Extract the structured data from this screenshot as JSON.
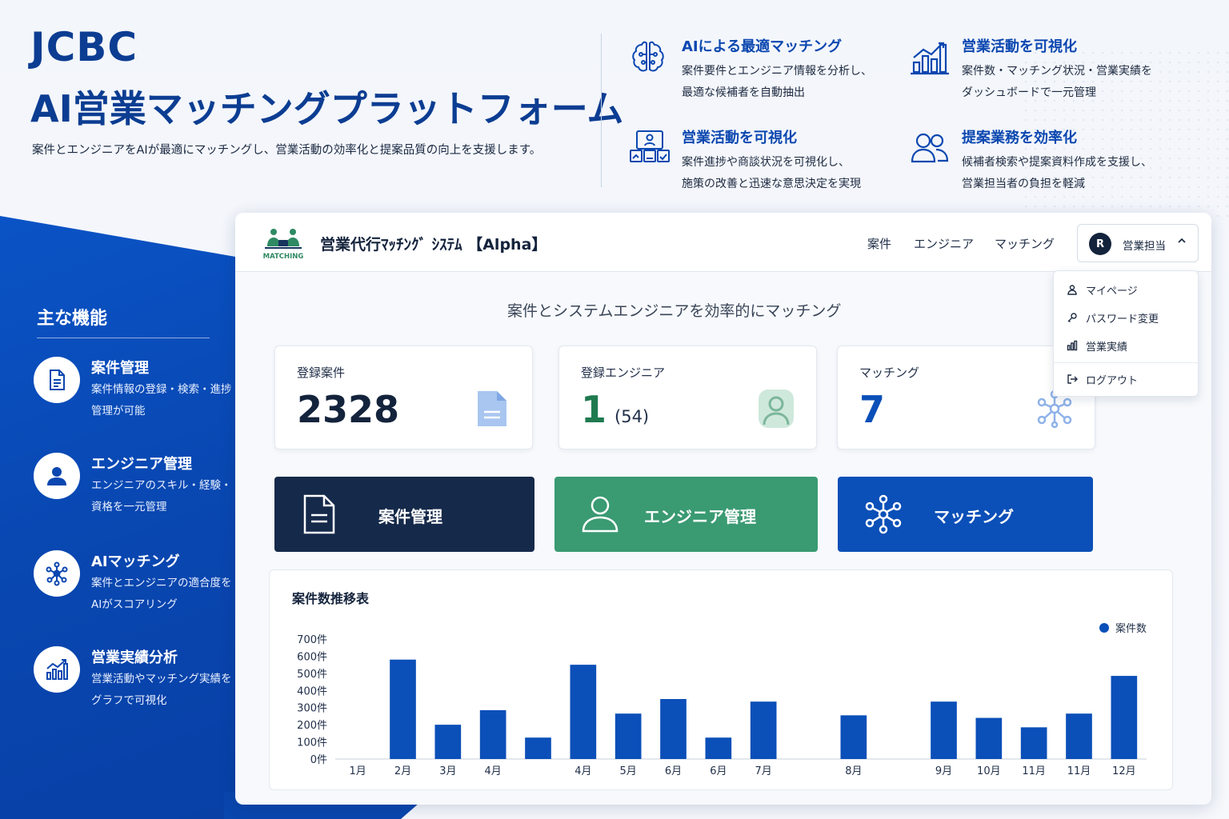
{
  "hero": {
    "title_line1": "JCBC",
    "title_line2": "AI営業マッチングプラットフォーム",
    "subtitle": "案件とエンジニアをAIが最適にマッチングし、営業活動の効率化と提案品質の向上を支援します。"
  },
  "features": [
    {
      "icon": "brain-icon",
      "title": "AIによる最適マッチング",
      "line1": "案件要件とエンジニア情報を分析し、",
      "line2": "最適な候補者を自動抽出"
    },
    {
      "icon": "bar-chart-icon",
      "title": "営業活動を可視化",
      "line1": "案件数・マッチング状況・営業実績を",
      "line2": "ダッシュボードで一元管理"
    },
    {
      "icon": "team-board-icon",
      "title": "営業活動を可視化",
      "line1": "案件進捗や商談状況を可視化し、",
      "line2": "施策の改善と迅速な意思決定を実現"
    },
    {
      "icon": "users-icon",
      "title": "提案業務を効率化",
      "line1": "候補者検索や提案資料作成を支援し、",
      "line2": "営業担当者の負担を軽減"
    }
  ],
  "side": {
    "heading": "主な機能",
    "items": [
      {
        "icon": "document-icon",
        "title": "案件管理",
        "desc": "案件情報の登録・検索・進捗管理が可能"
      },
      {
        "icon": "person-icon",
        "title": "エンジニア管理",
        "desc": "エンジニアのスキル・経験・資格を一元管理"
      },
      {
        "icon": "network-icon",
        "title": "AIマッチング",
        "desc": "案件とエンジニアの適合度をAIがスコアリング"
      },
      {
        "icon": "analytics-icon",
        "title": "営業実績分析",
        "desc": "営業活動やマッチング実績をグラフで可視化"
      }
    ]
  },
  "app": {
    "logo_text": "MATCHING",
    "title": "営業代行ﾏｯﾁﾝｸﾞ ｼｽﾃﾑ 【Alpha】",
    "nav": [
      "案件",
      "エンジニア",
      "マッチング"
    ],
    "user": {
      "initial": "R",
      "name": "営業担当"
    },
    "menu": [
      {
        "icon": "user-icon",
        "label": "マイページ"
      },
      {
        "icon": "key-icon",
        "label": "パスワード変更"
      },
      {
        "icon": "chart-icon",
        "label": "営業実績"
      },
      {
        "icon": "logout-icon",
        "label": "ログアウト"
      }
    ],
    "tagline": "案件とシステムエンジニアを効率的にマッチング",
    "stats": [
      {
        "label": "登録案件",
        "value": "2328",
        "sub": "",
        "color": "#14233c"
      },
      {
        "label": "登録エンジニア",
        "value": "1",
        "sub": "(54)",
        "color": "#1f7a4f"
      },
      {
        "label": "マッチング",
        "value": "7",
        "sub": "",
        "color": "#0b4fb8"
      }
    ],
    "actions": [
      {
        "label": "案件管理",
        "color": "#15294a"
      },
      {
        "label": "エンジニア管理",
        "color": "#3a9a72"
      },
      {
        "label": "マッチング",
        "color": "#0b4fb8"
      }
    ]
  },
  "chart_data": {
    "type": "bar",
    "title": "案件数推移表",
    "series": [
      {
        "name": "案件数",
        "color": "#0b4fb8",
        "values": [
          0,
          580,
          200,
          285,
          125,
          550,
          265,
          350,
          125,
          335,
          0,
          255,
          0,
          335,
          240,
          185,
          265,
          485
        ]
      }
    ],
    "categories": [
      "1月",
      "2月",
      "3月",
      "4月",
      "",
      "4月",
      "5月",
      "6月",
      "6月",
      "7月",
      "",
      "8月",
      "",
      "9月",
      "10月",
      "11月",
      "11月",
      "12月"
    ],
    "ylim": [
      0,
      700
    ],
    "yticks": [
      "0件",
      "100件",
      "200件",
      "300件",
      "400件",
      "500件",
      "600件",
      "700件"
    ],
    "grid": false,
    "legend": "top-right"
  }
}
